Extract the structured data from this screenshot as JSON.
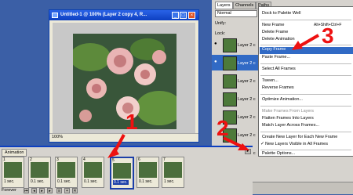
{
  "document_window": {
    "title": "Untitled-1 @ 100% (Layer 2 copy 4, R...",
    "zoom": "100%"
  },
  "layers_panel": {
    "tabs": [
      "Layers",
      "Channels",
      "Paths"
    ],
    "blend_mode": "Normal",
    "unify_label": "Unify:",
    "lock_label": "Lock:",
    "layers": [
      "Layer 2 c",
      "Layer 2 c",
      "Layer 2 c",
      "Layer 2 c",
      "Layer 2 c",
      "Layer 2 c",
      "Layer 2 c"
    ]
  },
  "context_menu": {
    "items": [
      {
        "label": "Dock to Palette Well",
        "state": "normal"
      },
      {
        "label": "New Frame",
        "state": "normal"
      },
      {
        "label": "Delete Frame",
        "state": "normal"
      },
      {
        "label": "Delete Animation",
        "state": "normal"
      },
      {
        "label": "Copy Frame",
        "state": "selected"
      },
      {
        "label": "Paste Frame...",
        "state": "normal"
      },
      {
        "label": "Select All Frames",
        "state": "normal"
      },
      {
        "label": "Tween...",
        "state": "normal"
      },
      {
        "label": "Reverse Frames",
        "state": "normal"
      },
      {
        "label": "Optimize Animation...",
        "state": "normal"
      },
      {
        "label": "Make Frames From Layers",
        "state": "disabled"
      },
      {
        "label": "Flatten Frames Into Layers",
        "state": "normal"
      },
      {
        "label": "Match Layer Across Frames...",
        "state": "normal"
      },
      {
        "label": "Create New Layer for Each New Frame",
        "state": "normal"
      },
      {
        "label": "New Layers Visible in All Frames",
        "state": "checked"
      },
      {
        "label": "Palette Options...",
        "state": "normal"
      }
    ],
    "shortcut": "Alt+Shift+Ctrl+F"
  },
  "animation_panel": {
    "tab": "Animation",
    "frames": [
      {
        "num": "1",
        "delay": "1 sec."
      },
      {
        "num": "2",
        "delay": "0.1 sec."
      },
      {
        "num": "3",
        "delay": "0.1 sec."
      },
      {
        "num": "4",
        "delay": "0.1 sec."
      },
      {
        "num": "5",
        "delay": "0.1 sec."
      },
      {
        "num": "6",
        "delay": "0.1 sec."
      },
      {
        "num": "7",
        "delay": "1 sec."
      }
    ],
    "loop": "Forever"
  },
  "annotations": [
    "1",
    "2",
    "3"
  ],
  "colors": {
    "highlight": "#316ac5",
    "annotation": "#ee1111",
    "titlebar": "#0d3fc0"
  }
}
